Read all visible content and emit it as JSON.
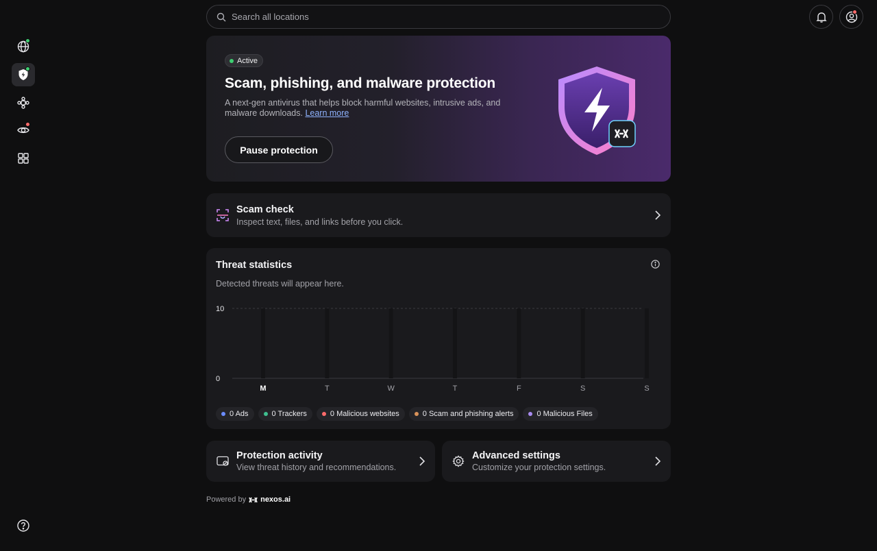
{
  "search": {
    "placeholder": "Search all locations"
  },
  "sidebar": {
    "items": [
      {
        "name": "globe-icon",
        "dot": "#3ecf72"
      },
      {
        "name": "shield-icon",
        "dot": "#3ecf72",
        "active": true
      },
      {
        "name": "mesh-icon"
      },
      {
        "name": "eye-icon",
        "dot": "#ff6b6b"
      },
      {
        "name": "apps-grid-icon"
      }
    ],
    "help": "help-icon"
  },
  "hero": {
    "badge": "Active",
    "title": "Scam, phishing, and malware protection",
    "description": "A next-gen antivirus that helps block harmful websites, intrusive ads, and malware downloads.",
    "learn_more": "Learn more",
    "button": "Pause protection"
  },
  "scam_check": {
    "title": "Scam check",
    "subtitle": "Inspect text, files, and links before you click."
  },
  "threats": {
    "title": "Threat statistics",
    "subtitle": "Detected threats will appear here.",
    "legend": [
      {
        "label": "0 Ads",
        "color": "#6b8cff"
      },
      {
        "label": "0 Trackers",
        "color": "#3fbf8f"
      },
      {
        "label": "0 Malicious websites",
        "color": "#ff6b6b"
      },
      {
        "label": "0 Scam and phishing alerts",
        "color": "#d9925a"
      },
      {
        "label": "0 Malicious Files",
        "color": "#a98bf0"
      }
    ]
  },
  "chart_data": {
    "type": "bar",
    "categories": [
      "M",
      "T",
      "W",
      "T",
      "F",
      "S",
      "S"
    ],
    "series": [
      {
        "name": "Ads",
        "values": [
          0,
          0,
          0,
          0,
          0,
          0,
          0
        ]
      },
      {
        "name": "Trackers",
        "values": [
          0,
          0,
          0,
          0,
          0,
          0,
          0
        ]
      },
      {
        "name": "Malicious websites",
        "values": [
          0,
          0,
          0,
          0,
          0,
          0,
          0
        ]
      },
      {
        "name": "Scam and phishing alerts",
        "values": [
          0,
          0,
          0,
          0,
          0,
          0,
          0
        ]
      },
      {
        "name": "Malicious Files",
        "values": [
          0,
          0,
          0,
          0,
          0,
          0,
          0
        ]
      }
    ],
    "yticks": [
      "0",
      "10"
    ],
    "ylim": [
      0,
      10
    ],
    "title": "Threat statistics",
    "xlabel": "",
    "ylabel": "",
    "highlighted_category_index": 0
  },
  "activity": {
    "title": "Protection activity",
    "subtitle": "View threat history and recommendations."
  },
  "advanced": {
    "title": "Advanced settings",
    "subtitle": "Customize your protection settings."
  },
  "footer": {
    "powered_by": "Powered by",
    "brand": "nexos.ai"
  },
  "colors": {
    "accent_green": "#3ecf72",
    "notification_red": "#ff6b6b"
  }
}
